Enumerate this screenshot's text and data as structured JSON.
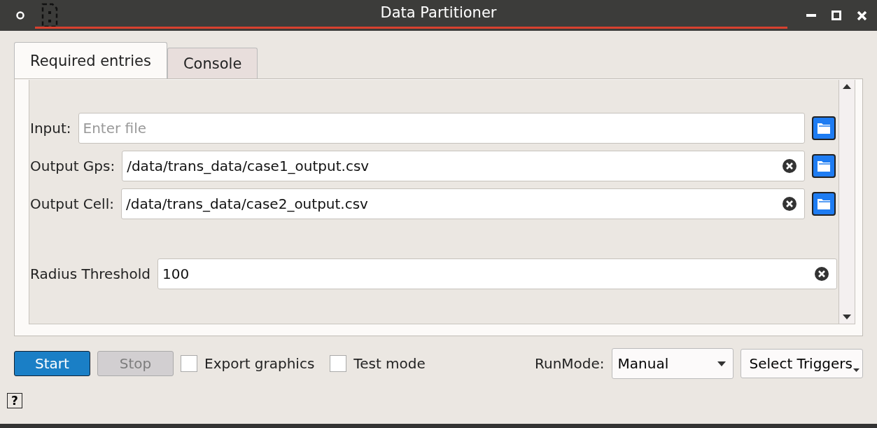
{
  "window": {
    "title": "Data Partitioner"
  },
  "tabs": [
    {
      "label": "Required entries",
      "selected": true
    },
    {
      "label": "Console",
      "selected": false
    }
  ],
  "fields": [
    {
      "label": "Input:",
      "placeholder": "Enter file",
      "browse": true
    },
    {
      "label": "Output Gps:",
      "value": "/data/trans_data/case1_output.csv",
      "browse": true
    },
    {
      "label": "Output Cell:",
      "value": "/data/trans_data/case2_output.csv",
      "browse": true
    },
    {
      "label": "Radius Threshold",
      "value": "100",
      "browse": false
    }
  ],
  "buttons": [
    {
      "label": "Start",
      "disabled": false
    },
    {
      "label": "Stop",
      "disabled": true
    }
  ],
  "checkboxes": [
    {
      "label": "Export graphics",
      "checked": false
    },
    {
      "label": "Test mode",
      "checked": false
    }
  ],
  "run_mode": {
    "label": "RunMode:",
    "value": "Manual"
  },
  "select_triggers": {
    "label": "Select Triggers"
  },
  "help": {
    "label": "?"
  }
}
